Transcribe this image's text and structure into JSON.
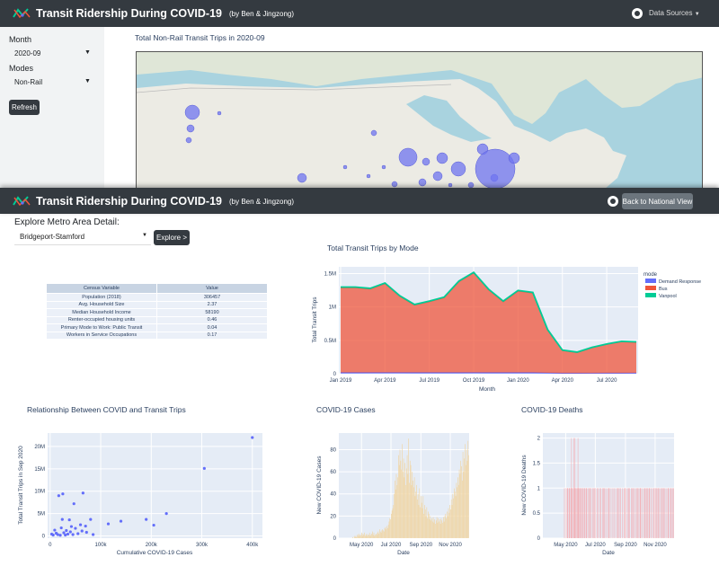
{
  "app": {
    "title": "Transit Ridership During COVID-19",
    "subtitle": "(by Ben & Jingzong)",
    "data_sources": "Data Sources",
    "back_button": "Back to National View"
  },
  "sidebar": {
    "month_label": "Month",
    "month_value": "2020-09",
    "modes_label": "Modes",
    "modes_value": "Non-Rail",
    "refresh": "Refresh"
  },
  "map": {
    "title": "Total Non-Rail Transit Trips in 2020-09"
  },
  "detail": {
    "heading": "Explore Metro Area Detail:",
    "metro_value": "Bridgeport-Stamford",
    "explore_button": "Explore >"
  },
  "census": {
    "headers": [
      "Census Variable",
      "Value"
    ],
    "rows": [
      [
        "Population (2018)",
        "306457"
      ],
      [
        "Avg. Household Size",
        "2.37"
      ],
      [
        "Median Household Income",
        "58190"
      ],
      [
        "Renter-occupied housing units",
        "0.46"
      ],
      [
        "Primary Mode to Work: Public Transit",
        "0.04"
      ],
      [
        "Workers in Service Occupations",
        "0.17"
      ]
    ]
  },
  "colors": {
    "navbar": "#343a40",
    "plot_bg": "#e5ecf6",
    "bus": "#ef553b",
    "vanpool": "#00cc96",
    "demand": "#636efa",
    "cases": "#f0d6a6",
    "deaths": "#f3aeb4"
  },
  "mode_chart": {
    "title": "Total Transit Trips by Mode",
    "chart_data": {
      "type": "area",
      "xlabel": "Month",
      "ylabel": "Total Transit Trips",
      "legend_title": "mode",
      "legend_position": "right",
      "x_ticks": [
        "Jan 2019",
        "Apr 2019",
        "Jul 2019",
        "Oct 2019",
        "Jan 2020",
        "Apr 2020",
        "Jul 2020"
      ],
      "y_ticks": [
        "0",
        "0.5M",
        "1M",
        "1.5M"
      ],
      "ylim": [
        0,
        1600000
      ],
      "x": [
        "2019-01",
        "2019-02",
        "2019-03",
        "2019-04",
        "2019-05",
        "2019-06",
        "2019-07",
        "2019-08",
        "2019-09",
        "2019-10",
        "2019-11",
        "2019-12",
        "2020-01",
        "2020-02",
        "2020-03",
        "2020-04",
        "2020-05",
        "2020-06",
        "2020-07",
        "2020-08",
        "2020-09"
      ],
      "series": [
        {
          "name": "Demand Response",
          "values": [
            18000,
            18000,
            19000,
            19000,
            19000,
            18000,
            18000,
            18000,
            18000,
            19000,
            18000,
            18000,
            18000,
            18000,
            14000,
            8000,
            8000,
            9000,
            10000,
            10000,
            11000
          ]
        },
        {
          "name": "Bus",
          "values": [
            1270000,
            1270000,
            1250000,
            1330000,
            1140000,
            1010000,
            1060000,
            1120000,
            1360000,
            1490000,
            1240000,
            1060000,
            1220000,
            1190000,
            640000,
            340000,
            310000,
            380000,
            430000,
            470000,
            460000
          ]
        },
        {
          "name": "Vanpool",
          "values": [
            9000,
            9000,
            9000,
            9000,
            9000,
            9000,
            9000,
            9000,
            9000,
            9000,
            9000,
            9000,
            9000,
            9000,
            8000,
            6000,
            6000,
            6000,
            6000,
            6000,
            6000
          ]
        }
      ]
    }
  },
  "scatter_chart": {
    "title": "Relationship Between COVID and Transit Trips",
    "chart_data": {
      "type": "scatter",
      "xlabel": "Cumulative COVID-19 Cases",
      "ylabel": "Total Transit Trips in Sep 2020",
      "x_ticks": [
        "0",
        "100k",
        "200k",
        "300k",
        "400k"
      ],
      "y_ticks": [
        "0",
        "5M",
        "10M",
        "15M",
        "20M"
      ],
      "xlim": [
        -5000,
        420000
      ],
      "ylim": [
        -500000,
        23000000
      ],
      "points": [
        [
          3000,
          400000
        ],
        [
          6000,
          200000
        ],
        [
          9000,
          1300000
        ],
        [
          12000,
          600000
        ],
        [
          15000,
          300000
        ],
        [
          17000,
          9000000
        ],
        [
          20000,
          150000
        ],
        [
          22000,
          1800000
        ],
        [
          24000,
          3700000
        ],
        [
          25000,
          9400000
        ],
        [
          27000,
          700000
        ],
        [
          30000,
          200000
        ],
        [
          32000,
          1200000
        ],
        [
          35000,
          400000
        ],
        [
          38000,
          3600000
        ],
        [
          40000,
          900000
        ],
        [
          42000,
          2100000
        ],
        [
          45000,
          300000
        ],
        [
          47000,
          7200000
        ],
        [
          50000,
          1700000
        ],
        [
          55000,
          500000
        ],
        [
          60000,
          2500000
        ],
        [
          63000,
          1100000
        ],
        [
          65000,
          9600000
        ],
        [
          70000,
          2200000
        ],
        [
          72000,
          800000
        ],
        [
          80000,
          3700000
        ],
        [
          85000,
          300000
        ],
        [
          115000,
          2700000
        ],
        [
          140000,
          3300000
        ],
        [
          190000,
          3700000
        ],
        [
          205000,
          2400000
        ],
        [
          230000,
          5000000
        ],
        [
          305000,
          15100000
        ],
        [
          400000,
          22000000
        ]
      ]
    }
  },
  "cases_chart": {
    "title": "COVID-19 Cases",
    "chart_data": {
      "type": "bar",
      "xlabel": "Date",
      "ylabel": "New COVID-19 Cases",
      "x_ticks": [
        "May 2020",
        "Jul 2020",
        "Sep 2020",
        "Nov 2020"
      ],
      "y_ticks": [
        "0",
        "20",
        "40",
        "60",
        "80"
      ],
      "ylim": [
        0,
        95
      ],
      "start_date": "2020-03-15",
      "end_date": "2020-12-10",
      "values": [
        0,
        0,
        0,
        0,
        0,
        0,
        0,
        0,
        0,
        0,
        0,
        0,
        0,
        0,
        0,
        0,
        0,
        0,
        0,
        1,
        0,
        2,
        1,
        2,
        1,
        3,
        2,
        4,
        3,
        2,
        3,
        5,
        2,
        4,
        3,
        5,
        2,
        3,
        4,
        2,
        3,
        3,
        5,
        2,
        3,
        4,
        6,
        3,
        5,
        2,
        3,
        4,
        3,
        5,
        6,
        4,
        8,
        6,
        5,
        7,
        8,
        7,
        6,
        9,
        10,
        8,
        11,
        9,
        12,
        15,
        18,
        17,
        22,
        25,
        27,
        30,
        40,
        52,
        44,
        58,
        48,
        55,
        75,
        66,
        80,
        70,
        62,
        85,
        60,
        72,
        55,
        68,
        48,
        63,
        75,
        58,
        90,
        50,
        70,
        66,
        48,
        60,
        52,
        46,
        55,
        38,
        42,
        48,
        35,
        40,
        30,
        45,
        28,
        38,
        32,
        27,
        38,
        22,
        30,
        26,
        20,
        28,
        18,
        24,
        22,
        17,
        20,
        16,
        18,
        15,
        19,
        14,
        17,
        13,
        16,
        19,
        14,
        18,
        15,
        17,
        13,
        18,
        16,
        14,
        19,
        15,
        20,
        22,
        18,
        24,
        20,
        27,
        23,
        30,
        26,
        35,
        30,
        40,
        36,
        45,
        42,
        38,
        50,
        46,
        55,
        48,
        62,
        58,
        70,
        65,
        52,
        78,
        60,
        72,
        85,
        66,
        80,
        70,
        88,
        75
      ]
    }
  },
  "deaths_chart": {
    "title": "COVID-19 Deaths",
    "chart_data": {
      "type": "bar",
      "xlabel": "Date",
      "ylabel": "New COVID-19 Deaths",
      "x_ticks": [
        "May 2020",
        "Jul 2020",
        "Sep 2020",
        "Nov 2020"
      ],
      "y_ticks": [
        "0",
        "0.5",
        "1",
        "1.5",
        "2"
      ],
      "ylim": [
        0,
        2.1
      ],
      "start_date": "2020-03-15",
      "end_date": "2020-12-10",
      "values": [
        0,
        0,
        0,
        0,
        0,
        0,
        0,
        0,
        0,
        0,
        0,
        0,
        0,
        0,
        0,
        0,
        0,
        0,
        0,
        0,
        0,
        0,
        0,
        0,
        0,
        0,
        0,
        0,
        0,
        0,
        0,
        0,
        0,
        0,
        0,
        0,
        1,
        0,
        0,
        1,
        0,
        1,
        1,
        0,
        1,
        1,
        0,
        1,
        2,
        1,
        0,
        1,
        2,
        1,
        2,
        1,
        0,
        1,
        1,
        2,
        1,
        1,
        0,
        1,
        1,
        1,
        0,
        1,
        1,
        0,
        1,
        1,
        0,
        1,
        1,
        0,
        0,
        1,
        1,
        0,
        1,
        1,
        0,
        0,
        1,
        1,
        0,
        1,
        0,
        1,
        0,
        0,
        1,
        1,
        0,
        0,
        1,
        0,
        1,
        0,
        0,
        1,
        1,
        0,
        1,
        0,
        1,
        0,
        0,
        1,
        0,
        1,
        1,
        0,
        0,
        1,
        0,
        0,
        1,
        0,
        1,
        0,
        0,
        1,
        0,
        0,
        1,
        1,
        0,
        1,
        0,
        1,
        0,
        0,
        1,
        0,
        0,
        1,
        1,
        0,
        1,
        0,
        0,
        1,
        0,
        1,
        1,
        0,
        0,
        1,
        0,
        1,
        0,
        1,
        1,
        0,
        0,
        1,
        0,
        1,
        1,
        0,
        1,
        0,
        1,
        1,
        0,
        1,
        0,
        0,
        1,
        0,
        1,
        1,
        0,
        1,
        0,
        1,
        0,
        1,
        1,
        0,
        1,
        0,
        1,
        0,
        0,
        1,
        1,
        0,
        1,
        0,
        1,
        0,
        1,
        1,
        0,
        1,
        0,
        1,
        0,
        1,
        0,
        1,
        1,
        0,
        1,
        0,
        1,
        0,
        0,
        1,
        1,
        0,
        1,
        0,
        1,
        1,
        0,
        1,
        0,
        1
      ]
    }
  }
}
